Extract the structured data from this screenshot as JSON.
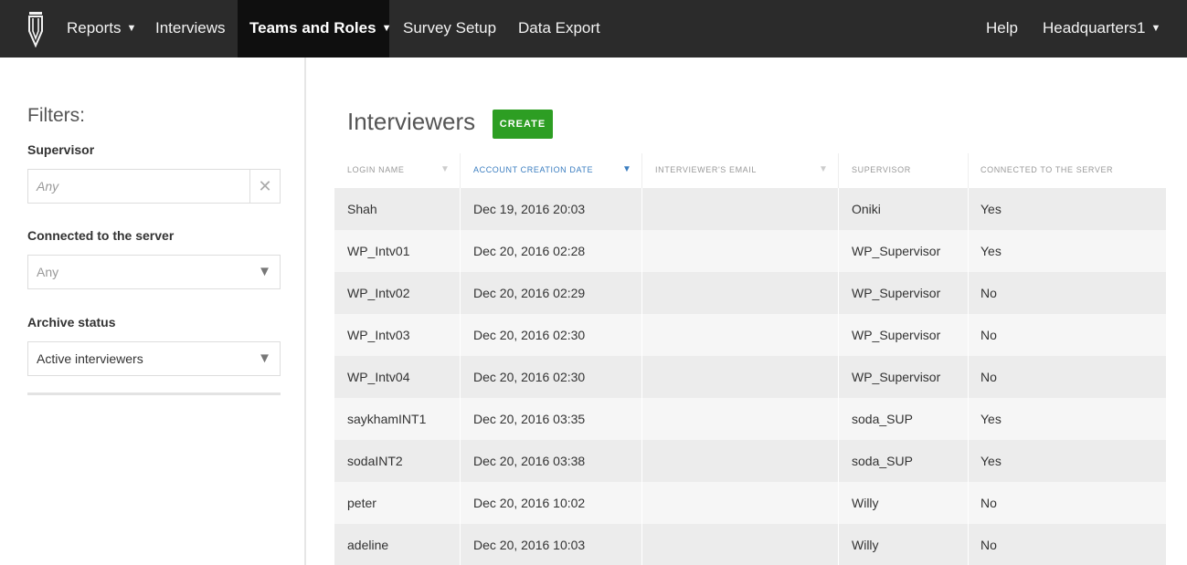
{
  "navbar": {
    "items": [
      {
        "label": "Reports",
        "has_caret": true
      },
      {
        "label": "Interviews",
        "has_caret": false
      },
      {
        "label": "Teams and Roles",
        "has_caret": true
      },
      {
        "label": "Survey Setup",
        "has_caret": false
      },
      {
        "label": "Data Export",
        "has_caret": false
      }
    ],
    "help": "Help",
    "account": "Headquarters1",
    "caret": "▼"
  },
  "filters": {
    "title": "Filters:",
    "supervisor": {
      "label": "Supervisor",
      "placeholder": "Any",
      "clear": "✕"
    },
    "connected": {
      "label": "Connected to the server",
      "value": "Any"
    },
    "archive": {
      "label": "Archive status",
      "value": "Active interviewers"
    },
    "dropdown_arrow": "▼"
  },
  "main": {
    "title": "Interviewers",
    "create_label": "CREATE"
  },
  "table": {
    "columns": [
      {
        "label": "LOGIN NAME",
        "sort": "▼"
      },
      {
        "label": "ACCOUNT CREATION DATE",
        "sort": "▼"
      },
      {
        "label": "INTERVIEWER'S EMAIL",
        "sort": "▼"
      },
      {
        "label": "SUPERVISOR"
      },
      {
        "label": "CONNECTED TO THE SERVER"
      }
    ],
    "rows": [
      {
        "login": "Shah",
        "created": "Dec 19, 2016 20:03",
        "email": "",
        "supervisor": "Oniki",
        "connected": "Yes"
      },
      {
        "login": "WP_Intv01",
        "created": "Dec 20, 2016 02:28",
        "email": "",
        "supervisor": "WP_Supervisor",
        "connected": "Yes"
      },
      {
        "login": "WP_Intv02",
        "created": "Dec 20, 2016 02:29",
        "email": "",
        "supervisor": "WP_Supervisor",
        "connected": "No"
      },
      {
        "login": "WP_Intv03",
        "created": "Dec 20, 2016 02:30",
        "email": "",
        "supervisor": "WP_Supervisor",
        "connected": "No"
      },
      {
        "login": "WP_Intv04",
        "created": "Dec 20, 2016 02:30",
        "email": "",
        "supervisor": "WP_Supervisor",
        "connected": "No"
      },
      {
        "login": "saykhamINT1",
        "created": "Dec 20, 2016 03:35",
        "email": "",
        "supervisor": "soda_SUP",
        "connected": "Yes"
      },
      {
        "login": "sodaINT2",
        "created": "Dec 20, 2016 03:38",
        "email": "",
        "supervisor": "soda_SUP",
        "connected": "Yes"
      },
      {
        "login": "peter",
        "created": "Dec 20, 2016 10:02",
        "email": "",
        "supervisor": "Willy",
        "connected": "No"
      },
      {
        "login": "adeline",
        "created": "Dec 20, 2016 10:03",
        "email": "",
        "supervisor": "Willy",
        "connected": "No"
      }
    ]
  },
  "colors": {
    "navbar_bg": "#2b2b2b",
    "navbar_active_bg": "#0f0f0f",
    "create_button": "#2d9e23",
    "sorted_column": "#3a7dc0"
  }
}
